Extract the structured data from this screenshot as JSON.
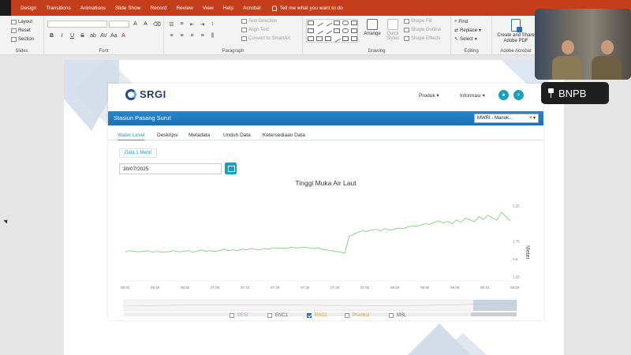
{
  "ribbon": {
    "tabs": [
      "Design",
      "Transitions",
      "Animations",
      "Slide Show",
      "Record",
      "Review",
      "View",
      "Help",
      "Acrobat"
    ],
    "tell_me": "Tell me what you want to do",
    "slides_group": {
      "layout": "Layout",
      "reset": "Reset",
      "section": "Section",
      "label": "Slides"
    },
    "font_group": {
      "label": "Font"
    },
    "paragraph_group": {
      "text_direction": "Text Direction",
      "align_text": "Align Text",
      "convert_smartart": "Convert to SmartArt",
      "label": "Paragraph"
    },
    "drawing_group": {
      "arrange": "Arrange",
      "quick_styles": "Quick Styles",
      "shape_fill": "Shape Fill",
      "shape_outline": "Shape Outline",
      "shape_effects": "Shape Effects",
      "label": "Drawing"
    },
    "editing_group": {
      "find": "Find",
      "replace": "Replace",
      "select": "Select",
      "label": "Editing"
    },
    "acrobat_group": {
      "create_share": "Create and Share Adobe PDF",
      "label": "Adobe Acrobat"
    }
  },
  "web": {
    "logo": "SRGI",
    "nav": {
      "produk": "Produk ▾",
      "informasi": "Informasi ▾"
    },
    "station_title": "Stasiun Pasang Surut",
    "station_select": "MWRI - Manok...",
    "tabs": [
      "Water Level",
      "Deskripsi",
      "Metadata",
      "Unduh Data",
      "Ketersediaan Data"
    ],
    "interval_pill": "Data 1 Menit",
    "date": "30/07/2025",
    "legend": [
      {
        "label": "PESI",
        "checked": false,
        "color": "#9aa7b8"
      },
      {
        "label": "ENC1",
        "checked": false,
        "color": "#666666"
      },
      {
        "label": "RAD1",
        "checked": true,
        "color": "#e0a040"
      },
      {
        "label": "Prediksi",
        "checked": false,
        "color": "#e0a040"
      },
      {
        "label": "MSL",
        "checked": false,
        "color": "#666666"
      }
    ]
  },
  "video": {
    "name": "BNPB"
  },
  "chart_data": {
    "type": "line",
    "title": "Tinggi Muka Air Laut",
    "ylabel": "Meter",
    "x_ticks": [
      "06:34",
      "06:40",
      "06:50",
      "07:00",
      "07:10",
      "07:20",
      "07:30",
      "07:40",
      "07:50",
      "08:40",
      "08:50",
      "09:00",
      "09:10",
      "09:20"
    ],
    "y_ticks": [
      "1.25",
      "1.5",
      "1.75",
      "2.25"
    ],
    "ylim": [
      1.25,
      2.25
    ],
    "series": [
      {
        "color": "#8fd18a",
        "values": [
          1.6,
          1.62,
          1.61,
          1.6,
          1.61,
          1.62,
          1.6,
          1.61,
          1.6,
          1.6,
          1.61,
          1.62,
          1.6,
          1.61,
          1.62,
          1.6,
          1.61,
          1.63,
          1.61,
          1.62,
          1.61,
          1.62,
          1.64,
          1.62,
          1.63,
          1.62,
          1.64,
          1.63,
          1.65,
          1.64,
          1.63,
          1.65,
          1.64,
          1.66,
          1.65,
          1.66,
          1.65,
          1.67,
          1.66,
          1.66,
          1.67,
          1.66,
          1.65,
          1.66,
          1.64,
          1.63,
          1.62,
          1.61,
          1.6,
          1.58,
          1.82,
          1.85,
          1.88,
          1.9,
          1.89,
          1.91,
          1.92,
          1.9,
          1.93,
          1.91,
          1.92,
          1.94,
          1.93,
          1.95,
          1.97,
          1.96,
          1.98,
          2.0,
          1.99,
          2.02,
          2.04,
          2.01,
          2.03,
          2.0,
          2.05,
          2.02,
          2.08,
          2.05,
          2.03,
          2.1,
          2.06,
          2.12,
          2.08,
          2.05,
          2.16,
          2.1,
          2.04
        ]
      }
    ]
  }
}
